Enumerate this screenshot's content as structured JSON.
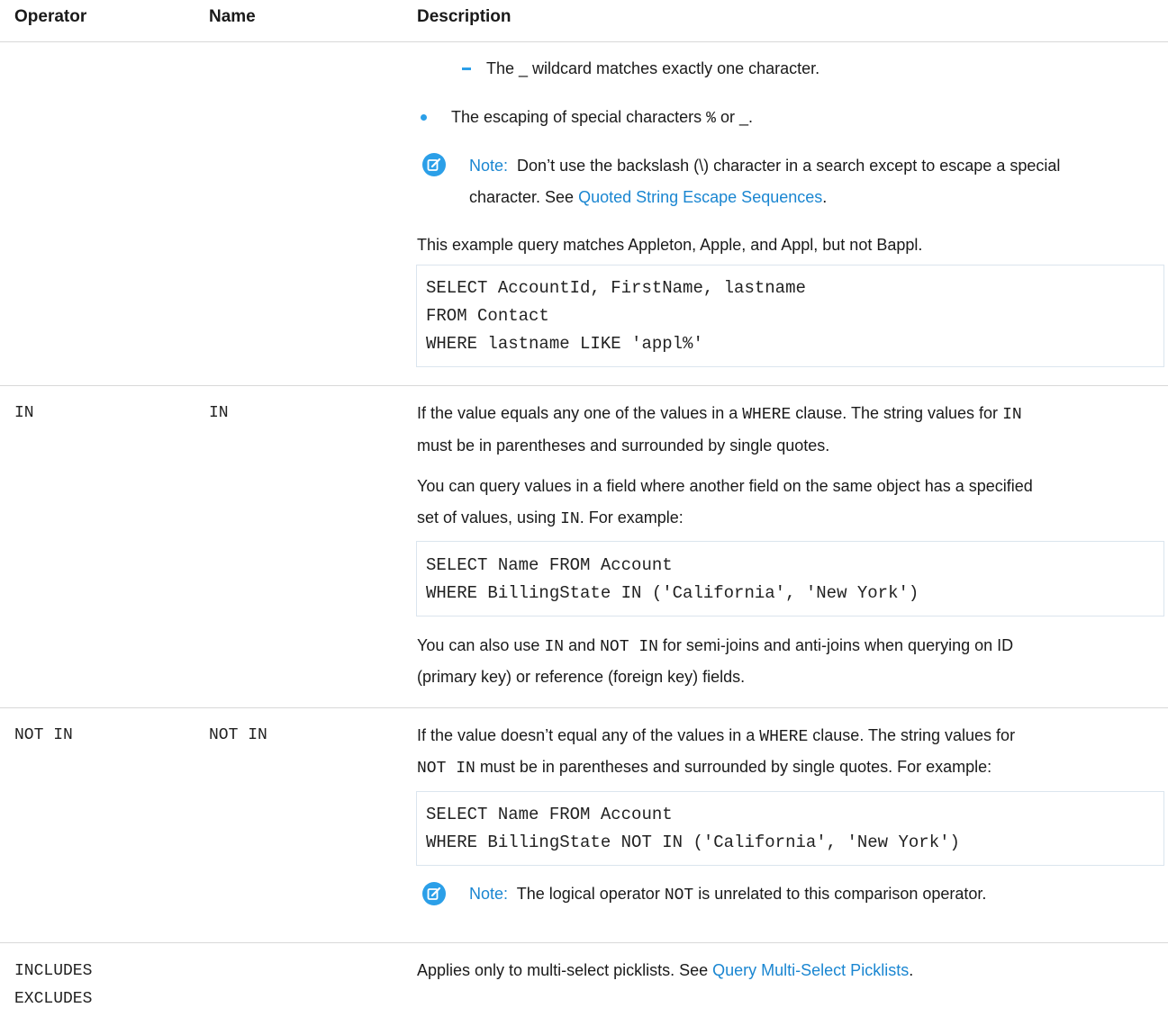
{
  "header": {
    "operator": "Operator",
    "name": "Name",
    "description": "Description"
  },
  "like_section": {
    "sub_bullet": "The _ wildcard matches exactly one character.",
    "bullet_prefix": "The escaping of special characters ",
    "bullet_pct": "%",
    "bullet_mid": " or ",
    "bullet_end": "_.",
    "note_label": "Note:",
    "note_line1": "Don’t use the backslash (\\) character in a search except to escape a special",
    "note_line2_prefix": "character. See ",
    "note_link": "Quoted String Escape Sequences",
    "note_line2_suffix": ".",
    "example_text": "This example query matches Appleton, Apple, and Appl, but not Bappl.",
    "code": [
      "SELECT AccountId, FirstName, lastname",
      "FROM Contact",
      "WHERE lastname LIKE 'appl%'"
    ]
  },
  "in_row": {
    "operator": "IN",
    "name": "IN",
    "p1_a": "If the value equals any one of the values in a ",
    "p1_code1": "WHERE",
    "p1_b": " clause. The string values for ",
    "p1_code2": "IN",
    "p1_c": "must be in parentheses and surrounded by single quotes.",
    "p2_a": "You can query values in a field where another field on the same object has a specified",
    "p2_b": "set of values, using ",
    "p2_code": "IN",
    "p2_c": ". For example:",
    "code": [
      "SELECT Name FROM Account",
      "WHERE BillingState IN ('California', 'New York')"
    ],
    "p3_a": "You can also use ",
    "p3_code1": "IN",
    "p3_b": " and ",
    "p3_code2": "NOT IN",
    "p3_c": " for semi-joins and anti-joins when querying on ID",
    "p3_d": "(primary key) or reference (foreign key) fields."
  },
  "not_in_row": {
    "operator": "NOT IN",
    "name": "NOT IN",
    "p1_a": "If the value doesn’t equal any of the values in a ",
    "p1_code1": "WHERE",
    "p1_b": " clause. The string values for",
    "p1_code2": "NOT IN",
    "p1_c": " must be in parentheses and surrounded by single quotes. For example:",
    "code": [
      "SELECT Name FROM Account",
      "WHERE BillingState NOT IN ('California', 'New York')"
    ],
    "note_label": "Note:",
    "note_a": "The logical operator ",
    "note_code": "NOT",
    "note_b": " is unrelated to this comparison operator."
  },
  "includes_row": {
    "operator1": "INCLUDES",
    "operator2": "EXCLUDES",
    "desc_a": "Applies only to multi-select picklists. See ",
    "desc_link": "Query Multi-Select Picklists",
    "desc_b": "."
  }
}
